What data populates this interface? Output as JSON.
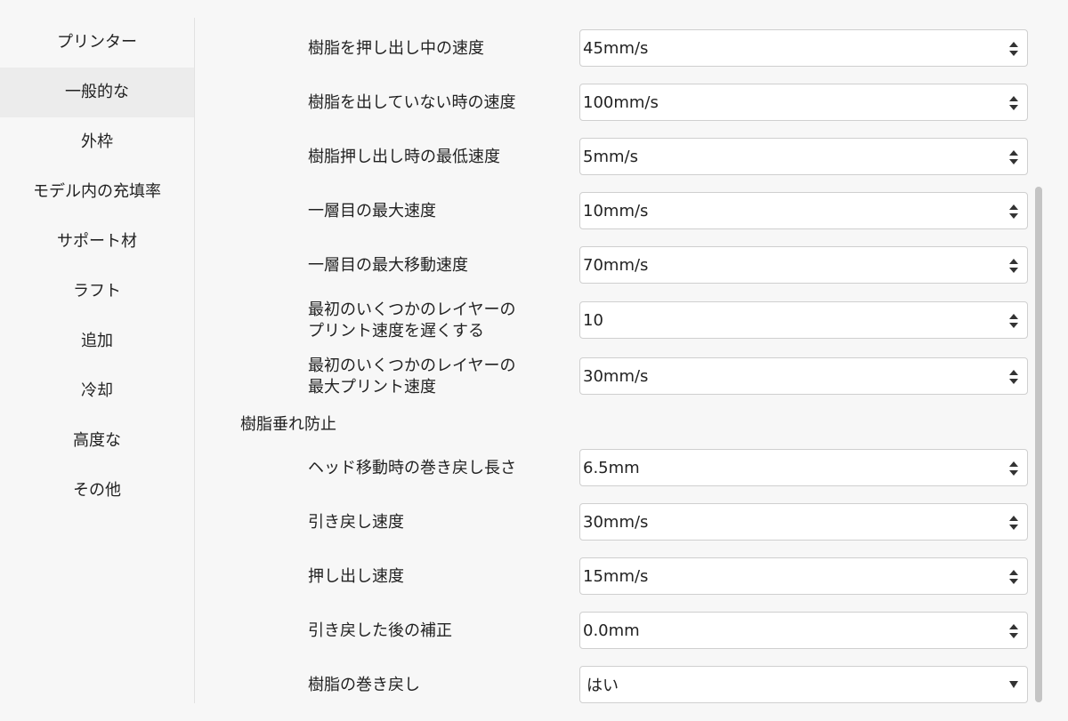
{
  "sidebar": {
    "items": [
      {
        "label": "プリンター",
        "active": false
      },
      {
        "label": "一般的な",
        "active": true
      },
      {
        "label": "外枠",
        "active": false
      },
      {
        "label": "モデル内の充填率",
        "active": false
      },
      {
        "label": "サポート材",
        "active": false
      },
      {
        "label": "ラフト",
        "active": false
      },
      {
        "label": "追加",
        "active": false
      },
      {
        "label": "冷却",
        "active": false
      },
      {
        "label": "高度な",
        "active": false
      },
      {
        "label": "その他",
        "active": false
      }
    ]
  },
  "settings": {
    "extrude_speed": {
      "label": "樹脂を押し出し中の速度",
      "value": "45mm/s"
    },
    "travel_speed": {
      "label": "樹脂を出していない時の速度",
      "value": "100mm/s"
    },
    "min_extrude_speed": {
      "label": "樹脂押し出し時の最低速度",
      "value": "5mm/s"
    },
    "first_layer_max_speed": {
      "label": "一層目の最大速度",
      "value": "10mm/s"
    },
    "first_layer_max_travel_speed": {
      "label": "一層目の最大移動速度",
      "value": "70mm/s"
    },
    "slow_layers": {
      "label_line1": "最初のいくつかのレイヤーの",
      "label_line2": "プリント速度を遅くする",
      "value": "10"
    },
    "slow_layers_max_speed": {
      "label_line1": "最初のいくつかのレイヤーの",
      "label_line2": "最大プリント速度",
      "value": "30mm/s"
    }
  },
  "retraction": {
    "section_title": "樹脂垂れ防止",
    "retract_length": {
      "label": "ヘッド移動時の巻き戻し長さ",
      "value": "6.5mm"
    },
    "retract_speed": {
      "label": "引き戻し速度",
      "value": "30mm/s"
    },
    "prime_speed": {
      "label": "押し出し速度",
      "value": "15mm/s"
    },
    "retract_offset": {
      "label": "引き戻した後の補正",
      "value": "0.0mm"
    },
    "filament_retract": {
      "label": "樹脂の巻き戻し",
      "value": "はい"
    }
  },
  "icons": {
    "spinner": "up-down-arrows-icon",
    "dropdown": "caret-down-icon"
  },
  "colors": {
    "background": "#f7f7f7",
    "active_item": "#ececec",
    "field_border": "#cfcfcf",
    "scrollbar": "#c4c4c4"
  }
}
